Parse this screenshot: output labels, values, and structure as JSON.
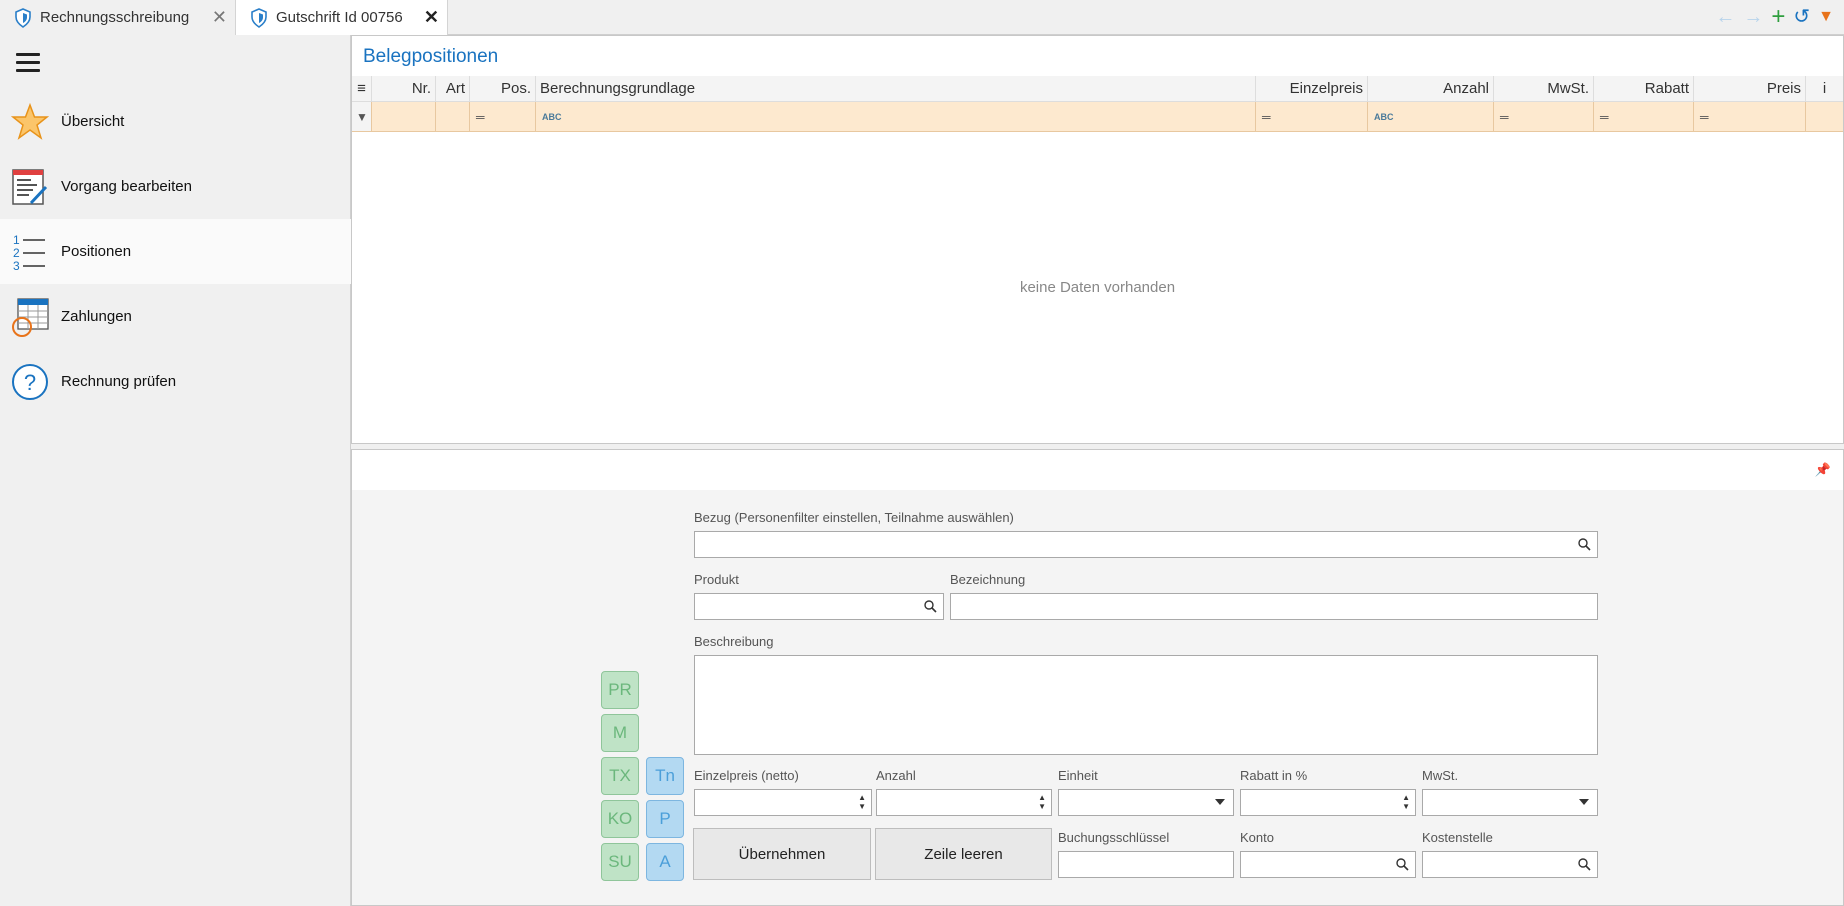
{
  "tabs": [
    {
      "label": "Rechnungsschreibung",
      "close": "✕"
    },
    {
      "label": "Gutschrift Id 00756",
      "close": "✕"
    }
  ],
  "toolbar": {
    "icons": [
      "arrow-left-icon",
      "arrow-right-icon",
      "add-icon",
      "refresh-icon",
      "dropdown-icon"
    ]
  },
  "sidebar": {
    "items": [
      {
        "label": "Übersicht",
        "icon": "star-icon"
      },
      {
        "label": "Vorgang bearbeiten",
        "icon": "edit-document-icon"
      },
      {
        "label": "Positionen",
        "icon": "numbered-list-icon"
      },
      {
        "label": "Zahlungen",
        "icon": "payments-icon"
      },
      {
        "label": "Rechnung prüfen",
        "icon": "help-icon"
      }
    ],
    "active": "Positionen"
  },
  "grid": {
    "title": "Belegpositionen",
    "columns": [
      "Nr.",
      "Art",
      "Pos.",
      "Berechnungsgrundlage",
      "Einzelpreis",
      "Anzahl",
      "MwSt.",
      "Rabatt",
      "Preis",
      "i"
    ],
    "empty_text": "keine Daten vorhanden"
  },
  "form": {
    "bezug_label": "Bezug (Personenfilter einstellen, Teilnahme auswählen)",
    "bezug_value": "",
    "produkt_label": "Produkt",
    "produkt_value": "",
    "bezeichnung_label": "Bezeichnung",
    "bezeichnung_value": "",
    "beschreibung_label": "Beschreibung",
    "beschreibung_value": "",
    "einzelpreis_label": "Einzelpreis (netto)",
    "anzahl_label": "Anzahl",
    "einheit_label": "Einheit",
    "rabatt_label": "Rabatt in %",
    "mwst_label": "MwSt.",
    "buchungsschluessel_label": "Buchungsschlüssel",
    "konto_label": "Konto",
    "kostenstelle_label": "Kostenstelle",
    "uebernehmen_label": "Übernehmen",
    "zeile_leeren_label": "Zeile leeren",
    "green_buttons": [
      "PR",
      "M",
      "TX",
      "KO",
      "SU"
    ],
    "blue_buttons": [
      "Tn",
      "P",
      "A"
    ]
  },
  "colors": {
    "accent": "#1a73c0",
    "filter_row": "#fde9cf",
    "green_btn": "#bfe3c6",
    "blue_btn": "#b3d9f2"
  }
}
